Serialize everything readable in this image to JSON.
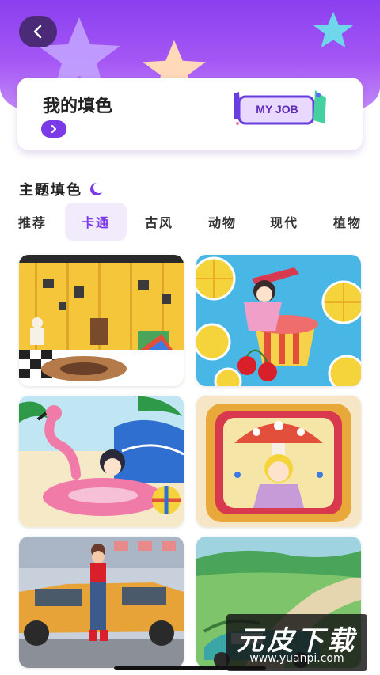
{
  "header": {
    "my_fill_title": "我的填色",
    "badge_text": "MY JOB"
  },
  "section": {
    "title": "主题填色"
  },
  "tabs": [
    {
      "label": "推荐",
      "active": false
    },
    {
      "label": "卡通",
      "active": true
    },
    {
      "label": "古风",
      "active": false
    },
    {
      "label": "动物",
      "active": false
    },
    {
      "label": "现代",
      "active": false
    },
    {
      "label": "植物",
      "active": false
    }
  ],
  "watermark": {
    "logo": "元皮下载",
    "url": "www.yuanpi.com"
  },
  "colors": {
    "accent": "#7b3ae8",
    "header": "#8a3ff0",
    "tab_active_bg": "#f2ebfb"
  }
}
